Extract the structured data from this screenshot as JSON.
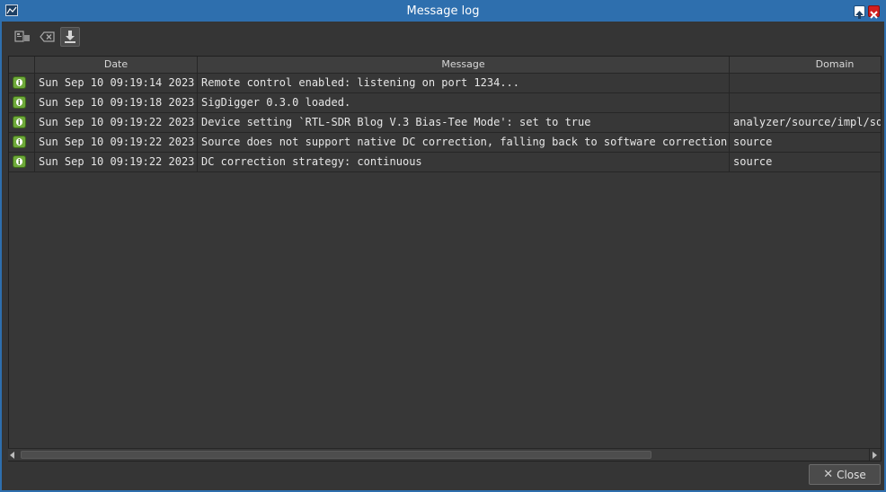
{
  "window": {
    "title": "Message log"
  },
  "toolbar": {
    "buttons": [
      {
        "icon": "copy-to-clipboard-icon"
      },
      {
        "icon": "clear-log-icon"
      },
      {
        "icon": "save-log-icon"
      }
    ]
  },
  "table": {
    "columns": [
      "",
      "Date",
      "Message",
      "Domain"
    ],
    "rows": [
      {
        "icon": "info-icon",
        "date": "Sun Sep 10 09:19:14 2023",
        "message": "Remote control enabled: listening on port 1234...",
        "domain": ""
      },
      {
        "icon": "info-icon",
        "date": "Sun Sep 10 09:19:18 2023",
        "message": "SigDigger 0.3.0 loaded.",
        "domain": ""
      },
      {
        "icon": "info-icon",
        "date": "Sun Sep 10 09:19:22 2023",
        "message": "Device setting `RTL-SDR Blog V.3 Bias-Tee Mode': set to true",
        "domain": "analyzer/source/impl/soapysdr"
      },
      {
        "icon": "info-icon",
        "date": "Sun Sep 10 09:19:22 2023",
        "message": "Source does not support native DC correction, falling back to software correction",
        "domain": "source"
      },
      {
        "icon": "info-icon",
        "date": "Sun Sep 10 09:19:22 2023",
        "message": "DC correction strategy: continuous",
        "domain": "source"
      }
    ]
  },
  "footer": {
    "close_label": "Close"
  }
}
